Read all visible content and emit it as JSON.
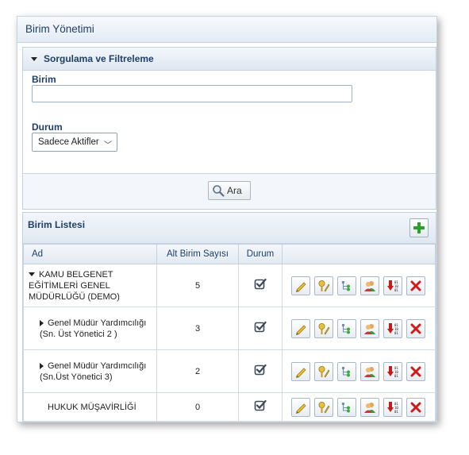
{
  "page": {
    "title": "Birim Yönetimi"
  },
  "filter": {
    "title": "Sorgulama ve Filtreleme",
    "birim_label": "Birim",
    "birim_value": "",
    "durum_label": "Durum",
    "durum_value": "Sadece Aktifler",
    "search_label": "Ara"
  },
  "list": {
    "title": "Birim Listesi",
    "columns": {
      "ad": "Ad",
      "alt": "Alt Birim Sayısı",
      "durum": "Durum"
    },
    "rows": [
      {
        "ad": "KAMU BELGENET EĞİTİMLERİ GENEL MÜDÜRLÜĞÜ (DEMO)",
        "alt": "5"
      },
      {
        "ad": "Genel Müdür Yardımcılığı (Sn. Üst Yönetici 2 )",
        "alt": "3"
      },
      {
        "ad": "Genel Müdür Yardımcılığı (Sn.Üst Yönetici 3)",
        "alt": "2"
      },
      {
        "ad": "HUKUK MÜŞAVİRLİĞİ",
        "alt": "0"
      }
    ]
  },
  "icons": [
    "tri-down-icon",
    "search-icon",
    "add-icon",
    "check-icon",
    "edit-icon",
    "key-icon",
    "tree-icon",
    "users-icon",
    "import-icon",
    "delete-icon"
  ],
  "colors": {
    "accent": "#1f3f66",
    "add": "#2aa12a",
    "delete": "#d11a1a"
  }
}
